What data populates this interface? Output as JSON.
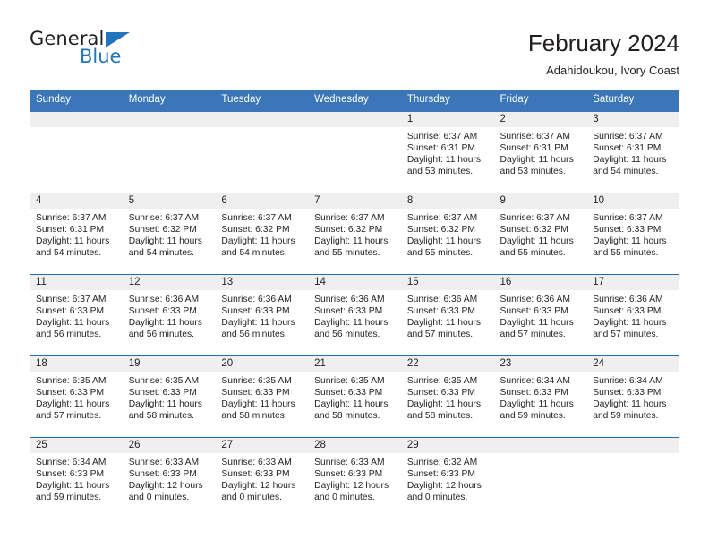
{
  "brand": {
    "name_top": "General",
    "name_bottom": "Blue",
    "accent_color": "#2175bc",
    "triangle_icon": "brand-triangle-icon"
  },
  "header": {
    "title": "February 2024",
    "location": "Adahidoukou, Ivory Coast"
  },
  "colors": {
    "header_blue": "#3a76b8",
    "divider_blue": "#1f6cb0",
    "daynum_band": "#efefef",
    "text": "#231f20"
  },
  "weekdays": [
    "Sunday",
    "Monday",
    "Tuesday",
    "Wednesday",
    "Thursday",
    "Friday",
    "Saturday"
  ],
  "labels": {
    "sunrise": "Sunrise:",
    "sunset": "Sunset:",
    "daylight": "Daylight:"
  },
  "weeks": [
    [
      {
        "day": "",
        "sunrise": "",
        "sunset": "",
        "daylight_a": "",
        "daylight_b": ""
      },
      {
        "day": "",
        "sunrise": "",
        "sunset": "",
        "daylight_a": "",
        "daylight_b": ""
      },
      {
        "day": "",
        "sunrise": "",
        "sunset": "",
        "daylight_a": "",
        "daylight_b": ""
      },
      {
        "day": "",
        "sunrise": "",
        "sunset": "",
        "daylight_a": "",
        "daylight_b": ""
      },
      {
        "day": "1",
        "sunrise": "Sunrise: 6:37 AM",
        "sunset": "Sunset: 6:31 PM",
        "daylight_a": "Daylight: 11 hours",
        "daylight_b": "and 53 minutes."
      },
      {
        "day": "2",
        "sunrise": "Sunrise: 6:37 AM",
        "sunset": "Sunset: 6:31 PM",
        "daylight_a": "Daylight: 11 hours",
        "daylight_b": "and 53 minutes."
      },
      {
        "day": "3",
        "sunrise": "Sunrise: 6:37 AM",
        "sunset": "Sunset: 6:31 PM",
        "daylight_a": "Daylight: 11 hours",
        "daylight_b": "and 54 minutes."
      }
    ],
    [
      {
        "day": "4",
        "sunrise": "Sunrise: 6:37 AM",
        "sunset": "Sunset: 6:31 PM",
        "daylight_a": "Daylight: 11 hours",
        "daylight_b": "and 54 minutes."
      },
      {
        "day": "5",
        "sunrise": "Sunrise: 6:37 AM",
        "sunset": "Sunset: 6:32 PM",
        "daylight_a": "Daylight: 11 hours",
        "daylight_b": "and 54 minutes."
      },
      {
        "day": "6",
        "sunrise": "Sunrise: 6:37 AM",
        "sunset": "Sunset: 6:32 PM",
        "daylight_a": "Daylight: 11 hours",
        "daylight_b": "and 54 minutes."
      },
      {
        "day": "7",
        "sunrise": "Sunrise: 6:37 AM",
        "sunset": "Sunset: 6:32 PM",
        "daylight_a": "Daylight: 11 hours",
        "daylight_b": "and 55 minutes."
      },
      {
        "day": "8",
        "sunrise": "Sunrise: 6:37 AM",
        "sunset": "Sunset: 6:32 PM",
        "daylight_a": "Daylight: 11 hours",
        "daylight_b": "and 55 minutes."
      },
      {
        "day": "9",
        "sunrise": "Sunrise: 6:37 AM",
        "sunset": "Sunset: 6:32 PM",
        "daylight_a": "Daylight: 11 hours",
        "daylight_b": "and 55 minutes."
      },
      {
        "day": "10",
        "sunrise": "Sunrise: 6:37 AM",
        "sunset": "Sunset: 6:33 PM",
        "daylight_a": "Daylight: 11 hours",
        "daylight_b": "and 55 minutes."
      }
    ],
    [
      {
        "day": "11",
        "sunrise": "Sunrise: 6:37 AM",
        "sunset": "Sunset: 6:33 PM",
        "daylight_a": "Daylight: 11 hours",
        "daylight_b": "and 56 minutes."
      },
      {
        "day": "12",
        "sunrise": "Sunrise: 6:36 AM",
        "sunset": "Sunset: 6:33 PM",
        "daylight_a": "Daylight: 11 hours",
        "daylight_b": "and 56 minutes."
      },
      {
        "day": "13",
        "sunrise": "Sunrise: 6:36 AM",
        "sunset": "Sunset: 6:33 PM",
        "daylight_a": "Daylight: 11 hours",
        "daylight_b": "and 56 minutes."
      },
      {
        "day": "14",
        "sunrise": "Sunrise: 6:36 AM",
        "sunset": "Sunset: 6:33 PM",
        "daylight_a": "Daylight: 11 hours",
        "daylight_b": "and 56 minutes."
      },
      {
        "day": "15",
        "sunrise": "Sunrise: 6:36 AM",
        "sunset": "Sunset: 6:33 PM",
        "daylight_a": "Daylight: 11 hours",
        "daylight_b": "and 57 minutes."
      },
      {
        "day": "16",
        "sunrise": "Sunrise: 6:36 AM",
        "sunset": "Sunset: 6:33 PM",
        "daylight_a": "Daylight: 11 hours",
        "daylight_b": "and 57 minutes."
      },
      {
        "day": "17",
        "sunrise": "Sunrise: 6:36 AM",
        "sunset": "Sunset: 6:33 PM",
        "daylight_a": "Daylight: 11 hours",
        "daylight_b": "and 57 minutes."
      }
    ],
    [
      {
        "day": "18",
        "sunrise": "Sunrise: 6:35 AM",
        "sunset": "Sunset: 6:33 PM",
        "daylight_a": "Daylight: 11 hours",
        "daylight_b": "and 57 minutes."
      },
      {
        "day": "19",
        "sunrise": "Sunrise: 6:35 AM",
        "sunset": "Sunset: 6:33 PM",
        "daylight_a": "Daylight: 11 hours",
        "daylight_b": "and 58 minutes."
      },
      {
        "day": "20",
        "sunrise": "Sunrise: 6:35 AM",
        "sunset": "Sunset: 6:33 PM",
        "daylight_a": "Daylight: 11 hours",
        "daylight_b": "and 58 minutes."
      },
      {
        "day": "21",
        "sunrise": "Sunrise: 6:35 AM",
        "sunset": "Sunset: 6:33 PM",
        "daylight_a": "Daylight: 11 hours",
        "daylight_b": "and 58 minutes."
      },
      {
        "day": "22",
        "sunrise": "Sunrise: 6:35 AM",
        "sunset": "Sunset: 6:33 PM",
        "daylight_a": "Daylight: 11 hours",
        "daylight_b": "and 58 minutes."
      },
      {
        "day": "23",
        "sunrise": "Sunrise: 6:34 AM",
        "sunset": "Sunset: 6:33 PM",
        "daylight_a": "Daylight: 11 hours",
        "daylight_b": "and 59 minutes."
      },
      {
        "day": "24",
        "sunrise": "Sunrise: 6:34 AM",
        "sunset": "Sunset: 6:33 PM",
        "daylight_a": "Daylight: 11 hours",
        "daylight_b": "and 59 minutes."
      }
    ],
    [
      {
        "day": "25",
        "sunrise": "Sunrise: 6:34 AM",
        "sunset": "Sunset: 6:33 PM",
        "daylight_a": "Daylight: 11 hours",
        "daylight_b": "and 59 minutes."
      },
      {
        "day": "26",
        "sunrise": "Sunrise: 6:33 AM",
        "sunset": "Sunset: 6:33 PM",
        "daylight_a": "Daylight: 12 hours",
        "daylight_b": "and 0 minutes."
      },
      {
        "day": "27",
        "sunrise": "Sunrise: 6:33 AM",
        "sunset": "Sunset: 6:33 PM",
        "daylight_a": "Daylight: 12 hours",
        "daylight_b": "and 0 minutes."
      },
      {
        "day": "28",
        "sunrise": "Sunrise: 6:33 AM",
        "sunset": "Sunset: 6:33 PM",
        "daylight_a": "Daylight: 12 hours",
        "daylight_b": "and 0 minutes."
      },
      {
        "day": "29",
        "sunrise": "Sunrise: 6:32 AM",
        "sunset": "Sunset: 6:33 PM",
        "daylight_a": "Daylight: 12 hours",
        "daylight_b": "and 0 minutes."
      },
      {
        "day": "",
        "sunrise": "",
        "sunset": "",
        "daylight_a": "",
        "daylight_b": ""
      },
      {
        "day": "",
        "sunrise": "",
        "sunset": "",
        "daylight_a": "",
        "daylight_b": ""
      }
    ]
  ]
}
